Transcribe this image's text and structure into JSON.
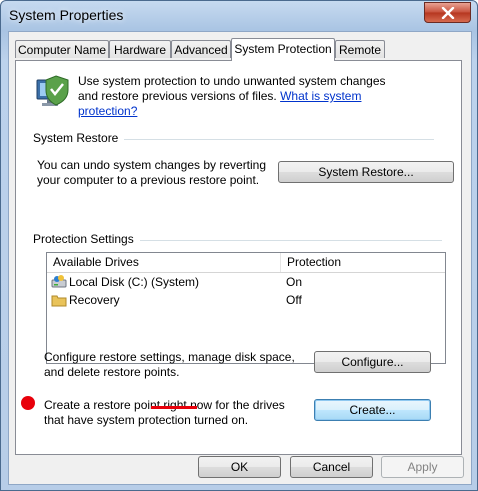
{
  "window": {
    "title": "System Properties",
    "close_icon": "close-icon"
  },
  "tabs": [
    {
      "label": "Computer Name"
    },
    {
      "label": "Hardware"
    },
    {
      "label": "Advanced"
    },
    {
      "label": "System Protection",
      "active": true
    },
    {
      "label": "Remote"
    }
  ],
  "intro": {
    "text": "Use system protection to undo unwanted system changes and restore previous versions of files.",
    "link": "What is system protection?",
    "icon": "system-protection-icon"
  },
  "system_restore": {
    "heading": "System Restore",
    "description": "You can undo system changes by reverting your computer to a previous restore point.",
    "button_label": "System Restore..."
  },
  "protection": {
    "heading": "Protection Settings",
    "columns": [
      "Available Drives",
      "Protection"
    ],
    "drives": [
      {
        "name": "Local Disk (C:) (System)",
        "protection": "On",
        "icon": "hard-drive-icon"
      },
      {
        "name": "Recovery",
        "protection": "Off",
        "icon": "folder-icon"
      }
    ],
    "configure_text": "Configure restore settings, manage disk space, and delete restore points.",
    "configure_label": "Configure...",
    "create_text": "Create a restore point right now for the drives that have system protection turned on.",
    "create_label": "Create..."
  },
  "footer": {
    "ok_label": "OK",
    "cancel_label": "Cancel",
    "apply_label": "Apply"
  },
  "annotation_color": "#e8000b"
}
